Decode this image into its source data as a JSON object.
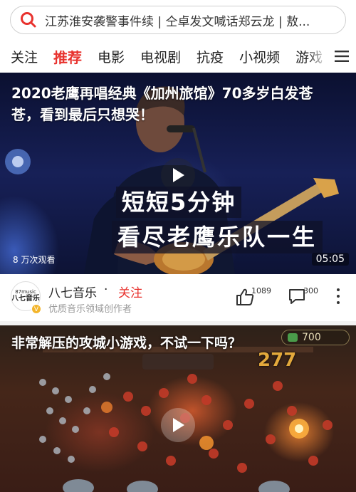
{
  "search": {
    "query": "江苏淮安袭警事件续 | 仝卓发文喊话郑云龙 | 敖..."
  },
  "tabs": [
    {
      "label": "关注",
      "active": false
    },
    {
      "label": "推荐",
      "active": true
    },
    {
      "label": "电影",
      "active": false
    },
    {
      "label": "电视剧",
      "active": false
    },
    {
      "label": "抗疫",
      "active": false
    },
    {
      "label": "小视频",
      "active": false
    },
    {
      "label": "游戏",
      "active": false
    }
  ],
  "colors": {
    "accent": "#e8322e",
    "verified": "#f3b52c"
  },
  "feed": [
    {
      "title": "2020老鹰再唱经典《加州旅馆》70多岁白发苍苍，看到最后只想哭！",
      "overlay_line1": "短短5分钟",
      "overlay_line2": "看尽老鹰乐队一生",
      "views": "8 万次观看",
      "duration": "05:05",
      "author": {
        "avatar_top": "87music",
        "avatar_bottom": "八七音乐",
        "name": "八七音乐",
        "separator": "·",
        "follow_label": "关注",
        "description": "优质音乐领域创作者",
        "verified_icon": "V"
      },
      "likes": "1089",
      "comments": "300"
    },
    {
      "title": "非常解压的攻城小游戏，不试一下吗？",
      "score": "700",
      "combo": "277"
    }
  ]
}
